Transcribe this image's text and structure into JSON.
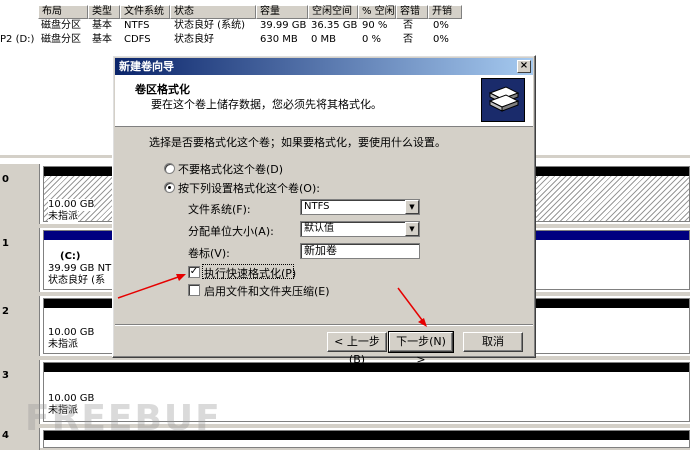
{
  "volume_list": {
    "headers": [
      "布局",
      "类型",
      "文件系统",
      "状态",
      "容量",
      "空闲空间",
      "% 空闲",
      "容错",
      "开销"
    ],
    "rows": [
      {
        "vol": "",
        "layout": "磁盘分区",
        "type": "基本",
        "fs": "NTFS",
        "status": "状态良好 (系统)",
        "capacity": "39.99 GB",
        "free": "36.35 GB",
        "pct": "90 %",
        "fault": "否",
        "overhead": "0%"
      },
      {
        "vol": "P2 (D:)",
        "layout": "磁盘分区",
        "type": "基本",
        "fs": "CDFS",
        "status": "状态良好",
        "capacity": "630 MB",
        "free": "0 MB",
        "pct": "0 %",
        "fault": "否",
        "overhead": "0%"
      }
    ]
  },
  "disks": [
    {
      "label": "0",
      "size": "10.00 GB",
      "state": "未指派"
    },
    {
      "label": "1",
      "name": "(C:)",
      "size": "39.99 GB NTF",
      "state": "状态良好 (系"
    },
    {
      "label": "2",
      "size": "10.00 GB",
      "state": "未指派"
    },
    {
      "label": "3",
      "size": "10.00 GB",
      "state": "未指派"
    },
    {
      "label": "4"
    }
  ],
  "dialog": {
    "title": "新建卷向导",
    "close": "×",
    "header_title": "卷区格式化",
    "header_subtitle": "要在这个卷上储存数据，您必须先将其格式化。",
    "intro": "选择是否要格式化这个卷；如果要格式化，要使用什么设置。",
    "radio_no_format": "不要格式化这个卷(D)",
    "radio_format": "按下列设置格式化这个卷(O):",
    "fs_label": "文件系统(F):",
    "fs_value": "NTFS",
    "alloc_label": "分配单位大小(A):",
    "alloc_value": "默认值",
    "vol_label": "卷标(V):",
    "vol_value": "新加卷",
    "quick_format": "执行快速格式化(P)",
    "compression": "启用文件和文件夹压缩(E)",
    "btn_back": "< 上一步(B)",
    "btn_next": "下一步(N) >",
    "btn_cancel": "取消",
    "selected_radio": "format",
    "quick_format_checked": true,
    "compression_checked": false
  },
  "watermark": "FREEBUF",
  "colors": {
    "titlebar": "#0a246a",
    "annotation": "#e60000",
    "partition_bar": "#000080"
  }
}
